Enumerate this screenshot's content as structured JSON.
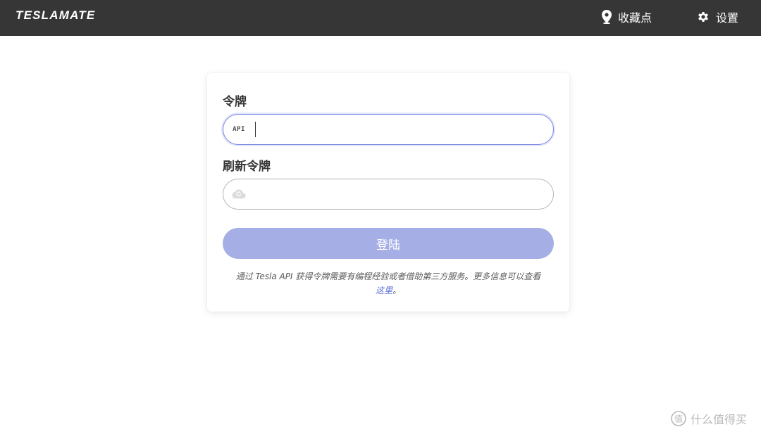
{
  "navbar": {
    "brand": "TESLAMATE",
    "places_label": "收藏点",
    "places_icon": "map-marker-icon",
    "settings_label": "设置",
    "settings_icon": "gear-icon"
  },
  "login_form": {
    "token_label": "令牌",
    "token_icon_text": "API",
    "token_value": "",
    "refresh_label": "刷新令牌",
    "refresh_icon": "cloud-refresh-icon",
    "refresh_value": "",
    "submit_label": "登陆",
    "help_text_prefix": "通过 Tesla API 获得令牌需要有编程经验或者借助第三方服务。更多信息可以查看",
    "help_link_label": "这里",
    "help_text_suffix": "。"
  },
  "watermark": {
    "text": "什么值得买",
    "icon": "zhi-logo-icon"
  },
  "colors": {
    "navbar_bg": "#363636",
    "accent": "#7a84e0",
    "button_disabled": "#a5afe5",
    "link": "#5b6cd6"
  }
}
